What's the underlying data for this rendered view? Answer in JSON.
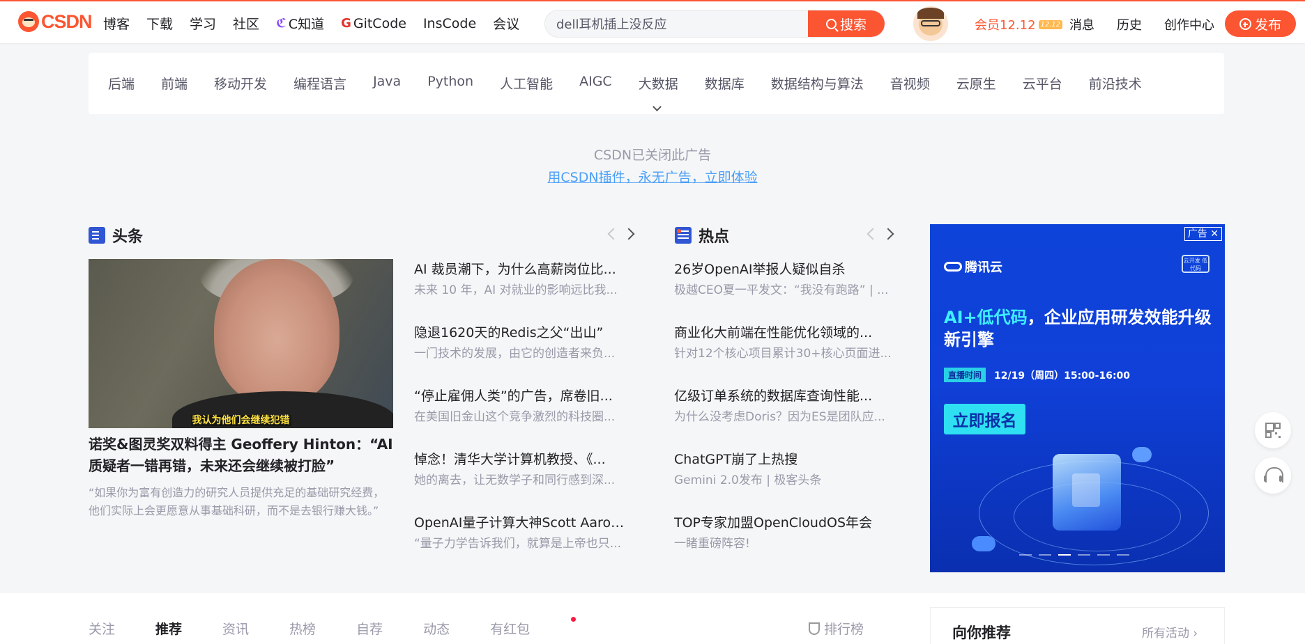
{
  "brand": {
    "logo_text": "CSDN",
    "accent": "#fc5531"
  },
  "nav": {
    "items": [
      {
        "label": "博客"
      },
      {
        "label": "下载"
      },
      {
        "label": "学习"
      },
      {
        "label": "社区"
      },
      {
        "label": "C知道",
        "icon": "c-zhidao-icon"
      },
      {
        "label": "GitCode",
        "icon": "gitcode-icon"
      },
      {
        "label": "InsCode"
      },
      {
        "label": "会议"
      }
    ]
  },
  "search": {
    "value": "dell耳机插上没反应",
    "button_label": "搜索"
  },
  "header_right": {
    "vip_label": "会员12.12",
    "vip_badge": "12.12",
    "links": [
      "消息",
      "历史",
      "创作中心"
    ],
    "publish_label": "发布"
  },
  "categories": [
    "后端",
    "前端",
    "移动开发",
    "编程语言",
    "Java",
    "Python",
    "人工智能",
    "AIGC",
    "大数据",
    "数据库",
    "数据结构与算法",
    "音视频",
    "云原生",
    "云平台",
    "前沿技术"
  ],
  "ad_notice": {
    "closed_text": "CSDN已关闭此广告",
    "link_text": "用CSDN插件，永无广告，立即体验"
  },
  "headlines": {
    "title": "头条",
    "main": {
      "image_caption": "我认为他们会继续犯错",
      "title": "诺奖&图灵奖双料得主 Geoffery Hinton：“AI质疑者一错再错，未来还会继续被打脸”",
      "desc": "“如果你为富有创造力的研究人员提供充足的基础研究经费，他们实际上会更愿意从事基础科研，而不是去银行赚大钱。”"
    },
    "items": [
      {
        "title": "AI 裁员潮下，为什么高薪岗位比...",
        "desc": "未来 10 年，AI 对就业的影响远比我..."
      },
      {
        "title": "隐退1620天的Redis之父“出山”",
        "desc": "一门技术的发展，由它的创造者来负..."
      },
      {
        "title": "“停止雇佣人类”的广告，席卷旧...",
        "desc": "在美国旧金山这个竞争激烈的科技圈..."
      },
      {
        "title": "悼念！清华大学计算机教授、《...",
        "desc": "她的离去，让无数学子和同行感到深..."
      },
      {
        "title": "OpenAI量子计算大神Scott Aaron...",
        "desc": "“量子力学告诉我们，就算是上帝也只..."
      }
    ]
  },
  "hot": {
    "title": "热点",
    "items": [
      {
        "title": "26岁OpenAI举报人疑似自杀",
        "desc": "极越CEO夏一平发文：“我没有跑路” | ..."
      },
      {
        "title": "商业化大前端在性能优化领域的...",
        "desc": "针对12个核心项目累计30+核心页面进..."
      },
      {
        "title": "亿级订单系统的数据库查询性能...",
        "desc": "为什么没考虑Doris？因为ES是团队应..."
      },
      {
        "title": "ChatGPT崩了上热搜",
        "desc": "Gemini 2.0发布 | 极客头条"
      },
      {
        "title": "TOP专家加盟OpenCloudOS年会",
        "desc": "一睹重磅阵容!"
      }
    ]
  },
  "ad_banner": {
    "badge": "广告",
    "close": "✕",
    "brand": "腾讯云",
    "dev_tag": "云开发 低代码",
    "headline_highlight": "AI+低代码",
    "headline_rest": "，企业应用研发效能升级新引擎",
    "time_label": "直播时间",
    "time_value": "12/19（周四）15:00-16:00",
    "cta": "立即报名",
    "slides": 6,
    "active_slide": 3
  },
  "feed_tabs": {
    "items": [
      "关注",
      "推荐",
      "资讯",
      "热榜",
      "自荐",
      "动态",
      "有红包"
    ],
    "active": "推荐",
    "rank_label": "排行榜"
  },
  "recommend": {
    "title": "向你推荐",
    "more": "所有活动"
  }
}
